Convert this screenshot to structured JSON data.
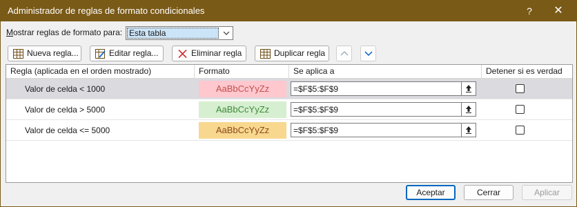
{
  "window": {
    "title": "Administrador de reglas de formato condicionales",
    "help_label": "?",
    "close_label": "✕"
  },
  "show_rules": {
    "label": "Mostrar reglas de formato para:",
    "selected": "Esta tabla"
  },
  "toolbar": {
    "new_rule": "Nueva regla...",
    "edit_rule": "Editar regla...",
    "delete_rule": "Eliminar regla",
    "duplicate_rule": "Duplicar regla"
  },
  "grid": {
    "columns": [
      "Regla (aplicada en el orden mostrado)",
      "Formato",
      "Se aplica a",
      "Detener si es verdad"
    ],
    "rows": [
      {
        "rule": "Valor de celda < 1000",
        "preview": "AaBbCcYyZz",
        "applies_to": "=$F$5:$F$9",
        "stop_if_true": false,
        "preview_bg": "#ffc7ce",
        "preview_fg": "#c0504d"
      },
      {
        "rule": "Valor de celda > 5000",
        "preview": "AaBbCcYyZz",
        "applies_to": "=$F$5:$F$9",
        "stop_if_true": false,
        "preview_bg": "#d6efd0",
        "preview_fg": "#3f8a3a"
      },
      {
        "rule": "Valor de celda <= 5000",
        "preview": "AaBbCcYyZz",
        "applies_to": "=$F$5:$F$9",
        "stop_if_true": false,
        "preview_bg": "#f8d78e",
        "preview_fg": "#8a4a1c"
      }
    ]
  },
  "buttons": {
    "accept": "Aceptar",
    "close": "Cerrar",
    "apply": "Aplicar"
  },
  "colors": {
    "titlebar": "#7a5a17",
    "selected_row": "#dadadf",
    "accent": "#0067c0"
  }
}
